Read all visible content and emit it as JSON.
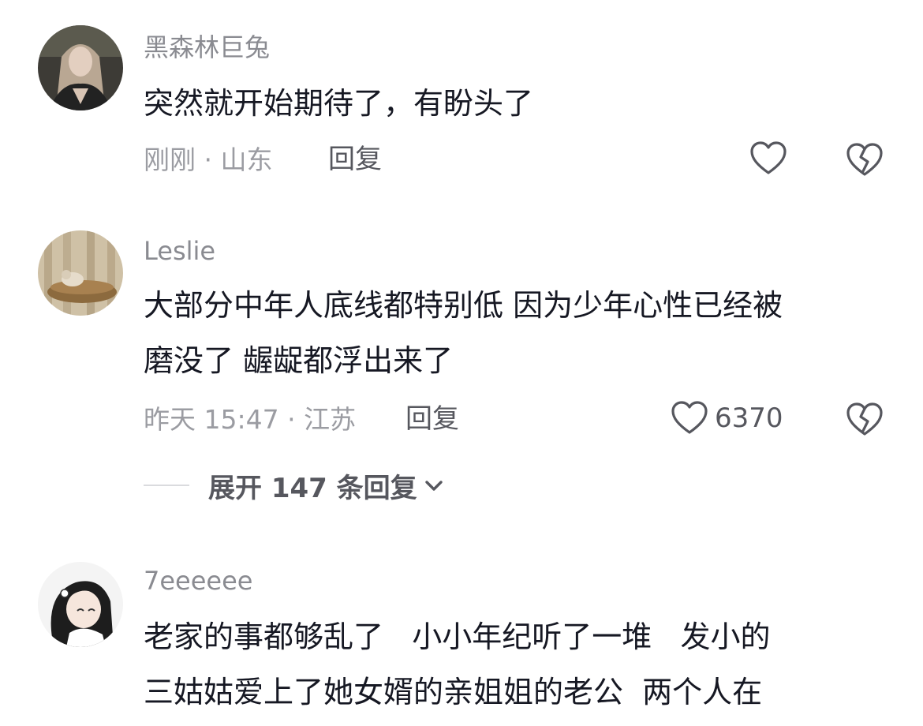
{
  "comments": [
    {
      "username": "黑森林巨兔",
      "text_lines": [
        "突然就开始期待了，有盼头了"
      ],
      "time": "刚刚",
      "location": "山东",
      "reply_label": "回复",
      "like_count": ""
    },
    {
      "username": "Leslie",
      "text_lines": [
        "大部分中年人底线都特别低 因为少年心性已经被",
        "磨没了 龌龊都浮出来了"
      ],
      "time": "昨天 15:47",
      "location": "江苏",
      "reply_label": "回复",
      "like_count": "6370",
      "expand_label": "展开 147 条回复"
    },
    {
      "username": "7eeeeee",
      "text_lines": [
        "老家的事都够乱了   小小年纪听了一堆   发小的",
        "三姑姑爱上了她女婿的亲姐姐的老公  两个人在"
      ]
    }
  ],
  "separator": "·",
  "icons": {
    "like": "heart-outline-icon",
    "dislike": "broken-heart-icon",
    "expand": "chevron-down-icon"
  },
  "colors": {
    "username": "#8a8b91",
    "text": "#161823",
    "meta": "#9b9ca2",
    "action": "#56575e"
  }
}
